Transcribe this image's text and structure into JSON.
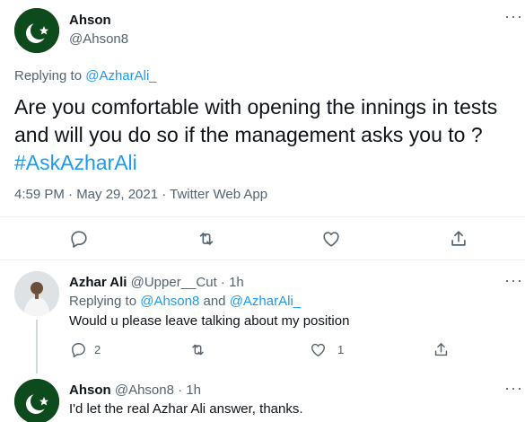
{
  "main_tweet": {
    "author_name": "Ahson",
    "author_handle": "@Ahson8",
    "more_icon": "more-dots-icon",
    "replying_prefix": "Replying to ",
    "replying_to": "@AzharAli_",
    "text": "Are you comfortable with opening the innings in tests and will you do so if the management asks you to ?",
    "hashtag": "#AskAzharAli",
    "timestamp": "4:59 PM · May 29, 2021 · Twitter Web App",
    "actions": [
      "reply-icon",
      "retweet-icon",
      "like-icon",
      "share-icon"
    ]
  },
  "replies": [
    {
      "author_name": "Azhar Ali",
      "author_handle": "@Upper__Cut",
      "time": "· 1h",
      "replying_prefix": "Replying to ",
      "replying_to_1": "@Ahson8",
      "replying_and": " and ",
      "replying_to_2": "@AzharAli_",
      "text": "Would u please leave talking about my position",
      "reply_count": "2",
      "retweet_count": "",
      "like_count": "1"
    },
    {
      "author_name": "Ahson",
      "author_handle": "@Ahson8",
      "time": "· 1h",
      "text": "I'd let the real Azhar Ali answer, thanks."
    }
  ],
  "colors": {
    "accent": "#1d9bf0",
    "text": "#0f1419",
    "secondary": "#536471",
    "flag_green": "#0d4a1c"
  }
}
